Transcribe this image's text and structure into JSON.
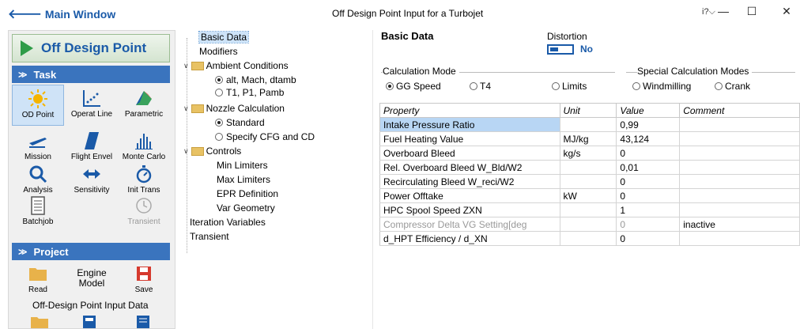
{
  "titlebar": {
    "back_label": "Main Window",
    "title": "Off Design Point Input for a Turbojet",
    "help": "i?",
    "minimize": "—",
    "maximize": "☐",
    "close": "✕"
  },
  "left_panel": {
    "header": "Off Design Point",
    "task_section": "Task",
    "project_section": "Project",
    "tools": [
      {
        "label": "OD Point"
      },
      {
        "label": "Operat Line"
      },
      {
        "label": "Parametric"
      },
      {
        "label": "Mission"
      },
      {
        "label": "Flight Envel"
      },
      {
        "label": "Monte Carlo"
      },
      {
        "label": "Analysis"
      },
      {
        "label": "Sensitivity"
      },
      {
        "label": "Init Trans"
      },
      {
        "label": "Batchjob"
      },
      {
        "label": "Transient"
      }
    ],
    "project_tools": [
      {
        "label": "Read"
      },
      {
        "label": "Engine Model"
      },
      {
        "label": "Save"
      }
    ],
    "footer_label": "Off-Design Point Input Data"
  },
  "tree": {
    "items": [
      "Basic Data",
      "Modifiers",
      "Ambient Conditions",
      "alt, Mach, dtamb",
      "T1, P1, Pamb",
      "Nozzle Calculation",
      "Standard",
      "Specify CFG and CD",
      "Controls",
      "Min Limiters",
      "Max Limiters",
      "EPR Definition",
      "Var Geometry",
      "Iteration Variables",
      "Transient"
    ]
  },
  "basic_data": {
    "title": "Basic Data",
    "distortion_label": "Distortion",
    "distortion_value": "No",
    "calc_mode_label": "Calculation Mode",
    "calc_modes": [
      "GG Speed",
      "T4",
      "Limits"
    ],
    "special_label": "Special Calculation Modes",
    "special_modes": [
      "Windmilling",
      "Crank"
    ]
  },
  "table": {
    "headers": [
      "Property",
      "Unit",
      "Value",
      "Comment"
    ],
    "rows": [
      {
        "property": "Intake Pressure Ratio",
        "unit": "",
        "value": "0,99",
        "comment": ""
      },
      {
        "property": "Fuel Heating Value",
        "unit": "MJ/kg",
        "value": "43,124",
        "comment": ""
      },
      {
        "property": "Overboard Bleed",
        "unit": "kg/s",
        "value": "0",
        "comment": ""
      },
      {
        "property": "Rel. Overboard Bleed W_Bld/W2",
        "unit": "",
        "value": "0,01",
        "comment": ""
      },
      {
        "property": "Recirculating Bleed W_reci/W2",
        "unit": "",
        "value": "0",
        "comment": ""
      },
      {
        "property": "Power Offtake",
        "unit": "kW",
        "value": "0",
        "comment": ""
      },
      {
        "property": "HPC Spool Speed ZXN",
        "unit": "",
        "value": "1",
        "comment": ""
      },
      {
        "property": "Compressor Delta VG Setting[deg",
        "unit": "",
        "value": "0",
        "comment": "inactive"
      },
      {
        "property": "d_HPT Efficiency / d_XN",
        "unit": "",
        "value": "0",
        "comment": ""
      }
    ]
  },
  "colors": {
    "accent_blue": "#1a5aa8",
    "section_bar": "#3a74be",
    "play_green": "#2e9c48",
    "selected_row": "#b8d6f4"
  }
}
